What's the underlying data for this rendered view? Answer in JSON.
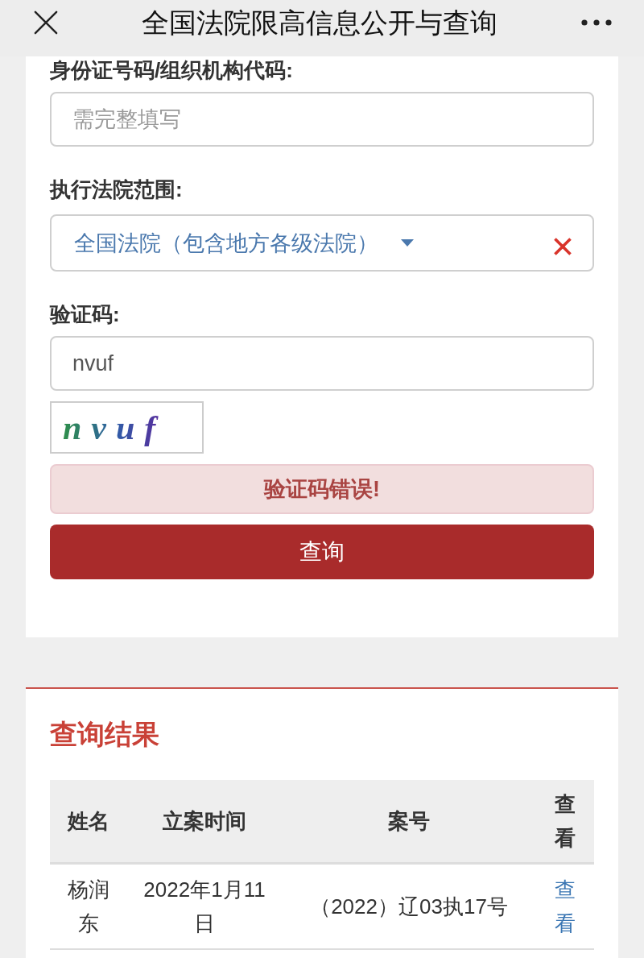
{
  "top_bar": {
    "title": "全国法院限高信息公开与查询"
  },
  "form": {
    "fields": [
      {
        "kind": "text",
        "label": "身份证号码/组织机构代码:",
        "placeholder": "需完整填写"
      },
      {
        "kind": "select",
        "label": "执行法院范围:",
        "value": "全国法院（包含地方各级法院）"
      },
      {
        "kind": "text",
        "label": "验证码:",
        "value": "nvuf"
      }
    ],
    "captcha": {
      "text": "nvuf"
    },
    "alert": {
      "kind": "error",
      "message": "验证码错误!"
    },
    "submit_button": "查询"
  },
  "results": {
    "title": "查询结果",
    "table": {
      "columns": [
        "姓名",
        "立案时间",
        "案号",
        "查看"
      ],
      "rows": [
        {
          "cells": [
            "杨润东",
            "2022年1月11日",
            "（2022）辽03执17号"
          ],
          "link": "查看"
        }
      ]
    }
  }
}
